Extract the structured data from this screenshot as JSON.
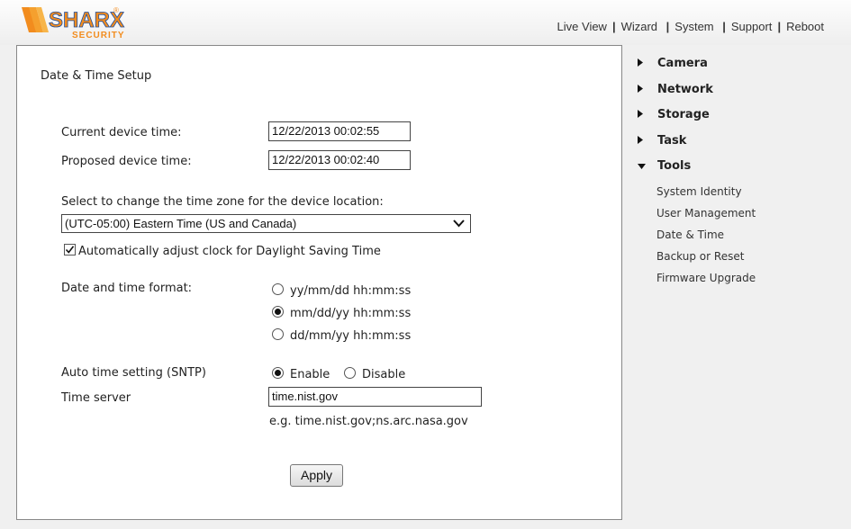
{
  "header": {
    "logo_text": "SHARX",
    "logo_sub": "SECURITY",
    "nav": [
      "Live View",
      "Wizard",
      "System",
      "Support",
      "Reboot"
    ]
  },
  "main": {
    "title": "Date & Time Setup",
    "current_time_label": "Current device time:",
    "current_time_value": "12/22/2013 00:02:55",
    "proposed_time_label": "Proposed device time:",
    "proposed_time_value": "12/22/2013 00:02:40",
    "timezone_label": "Select to change the time zone for the device location:",
    "timezone_selected": "(UTC-05:00) Eastern Time (US and Canada)",
    "dst_label": "Automatically adjust clock for Daylight Saving Time",
    "dst_checked": true,
    "format_label": "Date and time format:",
    "format_options": [
      "yy/mm/dd hh:mm:ss",
      "mm/dd/yy hh:mm:ss",
      "dd/mm/yy hh:mm:ss"
    ],
    "format_selected": "mm/dd/yy hh:mm:ss",
    "sntp_label": "Auto time setting (SNTP)",
    "sntp_enable": "Enable",
    "sntp_disable": "Disable",
    "sntp_selected": "Enable",
    "server_label": "Time server",
    "server_value": "time.nist.gov",
    "server_hint": "e.g. time.nist.gov;ns.arc.nasa.gov",
    "apply_label": "Apply"
  },
  "sidebar": {
    "items": [
      {
        "label": "Camera",
        "expanded": false
      },
      {
        "label": "Network",
        "expanded": false
      },
      {
        "label": "Storage",
        "expanded": false
      },
      {
        "label": "Task",
        "expanded": false
      },
      {
        "label": "Tools",
        "expanded": true
      }
    ],
    "tools_sub": [
      "System Identity",
      "User Management",
      "Date & Time",
      "Backup or Reset",
      "Firmware Upgrade"
    ]
  },
  "colors": {
    "logo_orange": "#f28c1e",
    "logo_blue": "#1d4e9e",
    "panel_bg": "#ffffff",
    "page_bg": "#f0f0f0"
  }
}
